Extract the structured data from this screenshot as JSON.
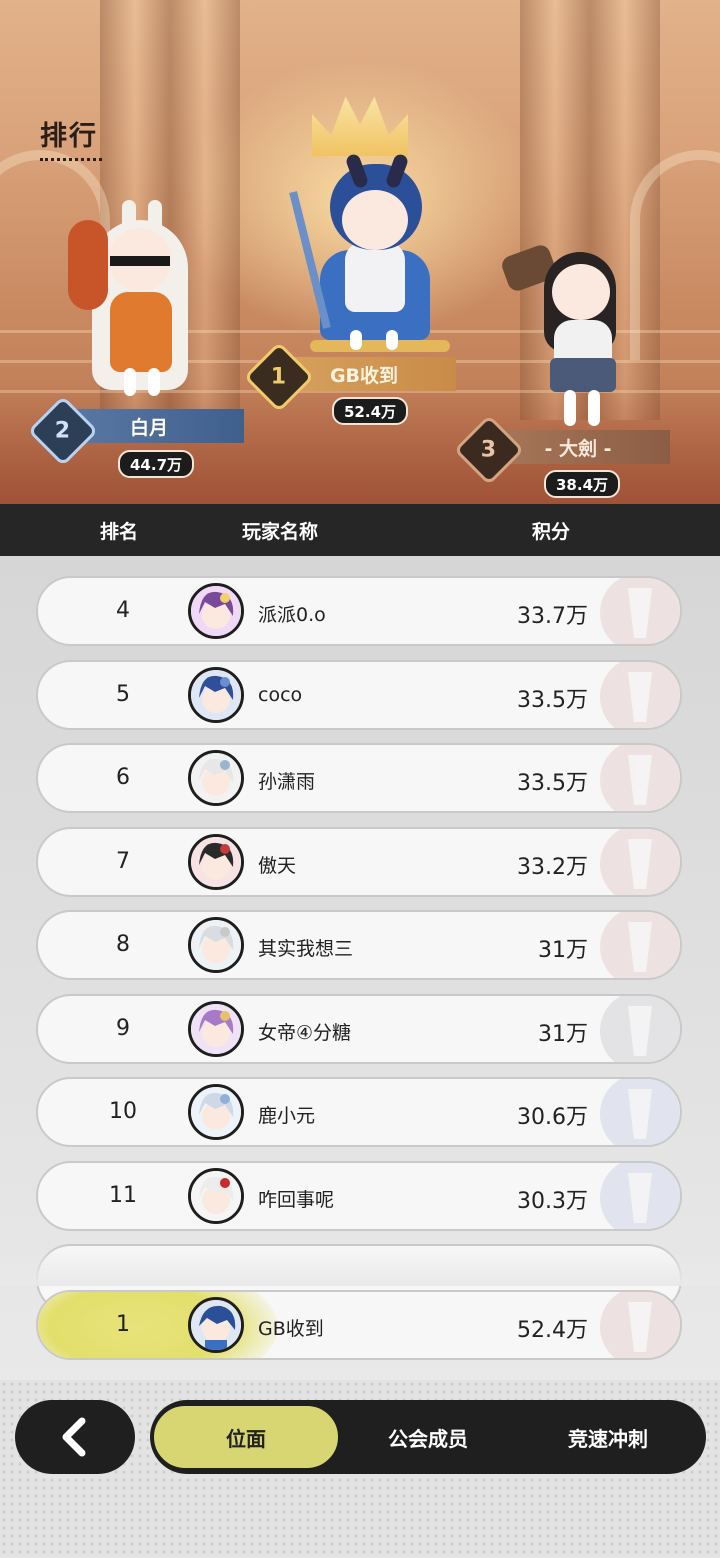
{
  "page": {
    "title": "排行"
  },
  "podium": [
    {
      "rank": "1",
      "name": "GB收到",
      "score": "52.4万"
    },
    {
      "rank": "2",
      "name": "白月",
      "score": "44.7万"
    },
    {
      "rank": "3",
      "name": "- 大劍 -",
      "score": "38.4万"
    }
  ],
  "table": {
    "headers": {
      "rank": "排名",
      "player": "玩家名称",
      "score": "积分"
    },
    "rows": [
      {
        "rank": "4",
        "name": "派派0.o",
        "score": "33.7万"
      },
      {
        "rank": "5",
        "name": "coco",
        "score": "33.5万"
      },
      {
        "rank": "6",
        "name": "孙潇雨",
        "score": "33.5万"
      },
      {
        "rank": "7",
        "name": "傲天",
        "score": "33.2万"
      },
      {
        "rank": "8",
        "name": "其实我想三",
        "score": "31万"
      },
      {
        "rank": "9",
        "name": "女帝④分糖",
        "score": "31万"
      },
      {
        "rank": "10",
        "name": "鹿小元",
        "score": "30.6万"
      },
      {
        "rank": "11",
        "name": "咋回事呢",
        "score": "30.3万"
      }
    ]
  },
  "self_row": {
    "rank": "1",
    "name": "GB收到",
    "score": "52.4万"
  },
  "nav": {
    "back_icon": "chevron-left-icon",
    "tabs": [
      {
        "label": "位面",
        "active": true
      },
      {
        "label": "公会成员",
        "active": false
      },
      {
        "label": "竞速冲刺",
        "active": false
      }
    ]
  },
  "colors": {
    "accent": "#d8d672",
    "header_bg": "#262626",
    "nav_bg": "#1f1f1f"
  }
}
